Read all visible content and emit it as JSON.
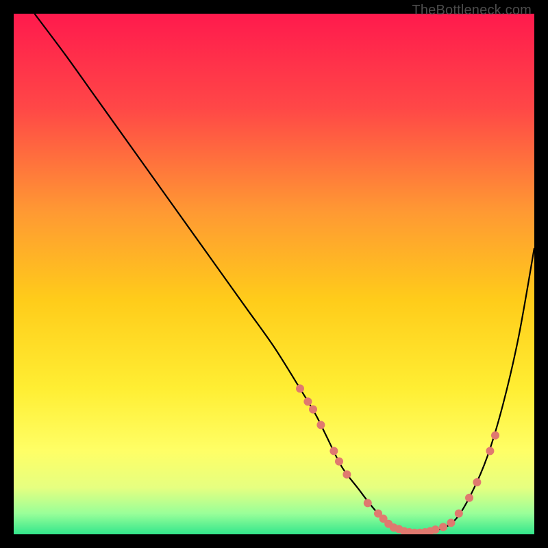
{
  "watermark": "TheBottleneck.com",
  "chart_data": {
    "type": "line",
    "title": "",
    "xlabel": "",
    "ylabel": "",
    "xlim": [
      0,
      100
    ],
    "ylim": [
      0,
      100
    ],
    "grid": false,
    "legend": false,
    "series": [
      {
        "name": "curve",
        "x": [
          4,
          10,
          15,
          20,
          25,
          30,
          35,
          40,
          45,
          50,
          55,
          58,
          60,
          63,
          66,
          70,
          74,
          78,
          82,
          85,
          88,
          91,
          94,
          97,
          100
        ],
        "y": [
          100,
          92,
          85,
          78,
          71,
          64,
          57,
          50,
          43,
          36,
          28,
          23,
          19,
          13,
          9,
          4,
          1,
          0.3,
          1,
          3,
          8,
          15,
          25,
          38,
          55
        ],
        "color": "#000000",
        "width": 2.2
      }
    ],
    "dots_color": "#e0796f",
    "dots_radius": 6,
    "dots": [
      {
        "x": 55,
        "y": 28
      },
      {
        "x": 56.5,
        "y": 25.5
      },
      {
        "x": 57.5,
        "y": 24
      },
      {
        "x": 59,
        "y": 21
      },
      {
        "x": 61.5,
        "y": 16
      },
      {
        "x": 62.5,
        "y": 14
      },
      {
        "x": 64,
        "y": 11.5
      },
      {
        "x": 68,
        "y": 6
      },
      {
        "x": 70,
        "y": 4
      },
      {
        "x": 71,
        "y": 3
      },
      {
        "x": 72,
        "y": 2
      },
      {
        "x": 73,
        "y": 1.3
      },
      {
        "x": 74,
        "y": 1
      },
      {
        "x": 75,
        "y": 0.6
      },
      {
        "x": 76,
        "y": 0.4
      },
      {
        "x": 77,
        "y": 0.3
      },
      {
        "x": 78,
        "y": 0.3
      },
      {
        "x": 79,
        "y": 0.4
      },
      {
        "x": 80,
        "y": 0.6
      },
      {
        "x": 81,
        "y": 0.9
      },
      {
        "x": 82.5,
        "y": 1.4
      },
      {
        "x": 84,
        "y": 2.2
      },
      {
        "x": 85.5,
        "y": 4
      },
      {
        "x": 87.5,
        "y": 7
      },
      {
        "x": 89,
        "y": 10
      },
      {
        "x": 91.5,
        "y": 16
      },
      {
        "x": 92.5,
        "y": 19
      }
    ],
    "gradient_stops": [
      {
        "offset": 0,
        "color": "#ff1a4d"
      },
      {
        "offset": 18,
        "color": "#ff4747"
      },
      {
        "offset": 38,
        "color": "#ff9933"
      },
      {
        "offset": 55,
        "color": "#ffcc1a"
      },
      {
        "offset": 72,
        "color": "#ffee33"
      },
      {
        "offset": 84,
        "color": "#ffff66"
      },
      {
        "offset": 91,
        "color": "#e6ff80"
      },
      {
        "offset": 96,
        "color": "#99ff99"
      },
      {
        "offset": 100,
        "color": "#33e68c"
      }
    ]
  }
}
